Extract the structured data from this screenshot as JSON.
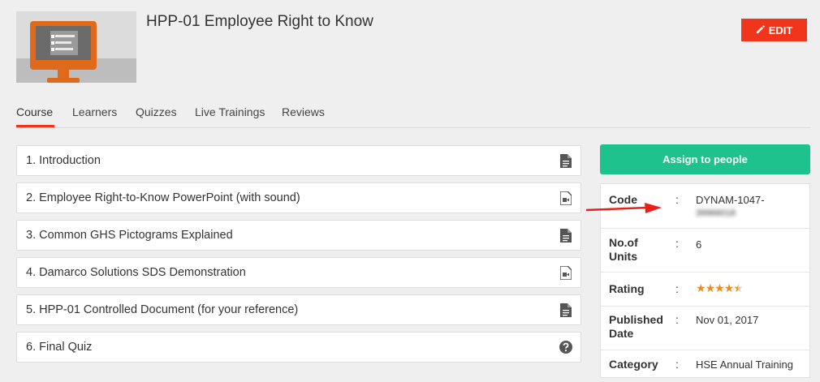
{
  "course": {
    "title": "HPP-01 Employee Right to Know",
    "edit_label": "EDIT"
  },
  "tabs": [
    {
      "label": "Course",
      "active": true
    },
    {
      "label": "Learners"
    },
    {
      "label": "Quizzes"
    },
    {
      "label": "Live Trainings"
    },
    {
      "label": "Reviews"
    }
  ],
  "lessons": [
    {
      "label": "1. Introduction",
      "icon": "document-icon"
    },
    {
      "label": "2. Employee Right-to-Know PowerPoint (with sound)",
      "icon": "video-icon"
    },
    {
      "label": "3. Common GHS Pictograms Explained",
      "icon": "document-icon"
    },
    {
      "label": "4. Damarco Solutions SDS Demonstration",
      "icon": "video-icon"
    },
    {
      "label": "5. HPP-01 Controlled Document (for your reference)",
      "icon": "document-icon"
    },
    {
      "label": "6. Final Quiz",
      "icon": "question-icon"
    }
  ],
  "sidebar": {
    "assign_label": "Assign to people",
    "info": {
      "code_label": "Code",
      "code_value": "DYNAM-1047-",
      "code_value_hidden": "39966018",
      "units_label_1": "No.of",
      "units_label_2": "Units",
      "units_value": "6",
      "rating_label": "Rating",
      "rating_value": 4.5,
      "rating_max": 5,
      "published_label_1": "Published",
      "published_label_2": "Date",
      "published_value": "Nov 01, 2017",
      "category_label": "Category",
      "category_value": "HSE Annual Training",
      "separator": ":"
    }
  },
  "colors": {
    "accent": "#f0351c",
    "assign": "#1ec28c",
    "thumbnail": "#e06a1c",
    "star": "#f08a1e"
  }
}
